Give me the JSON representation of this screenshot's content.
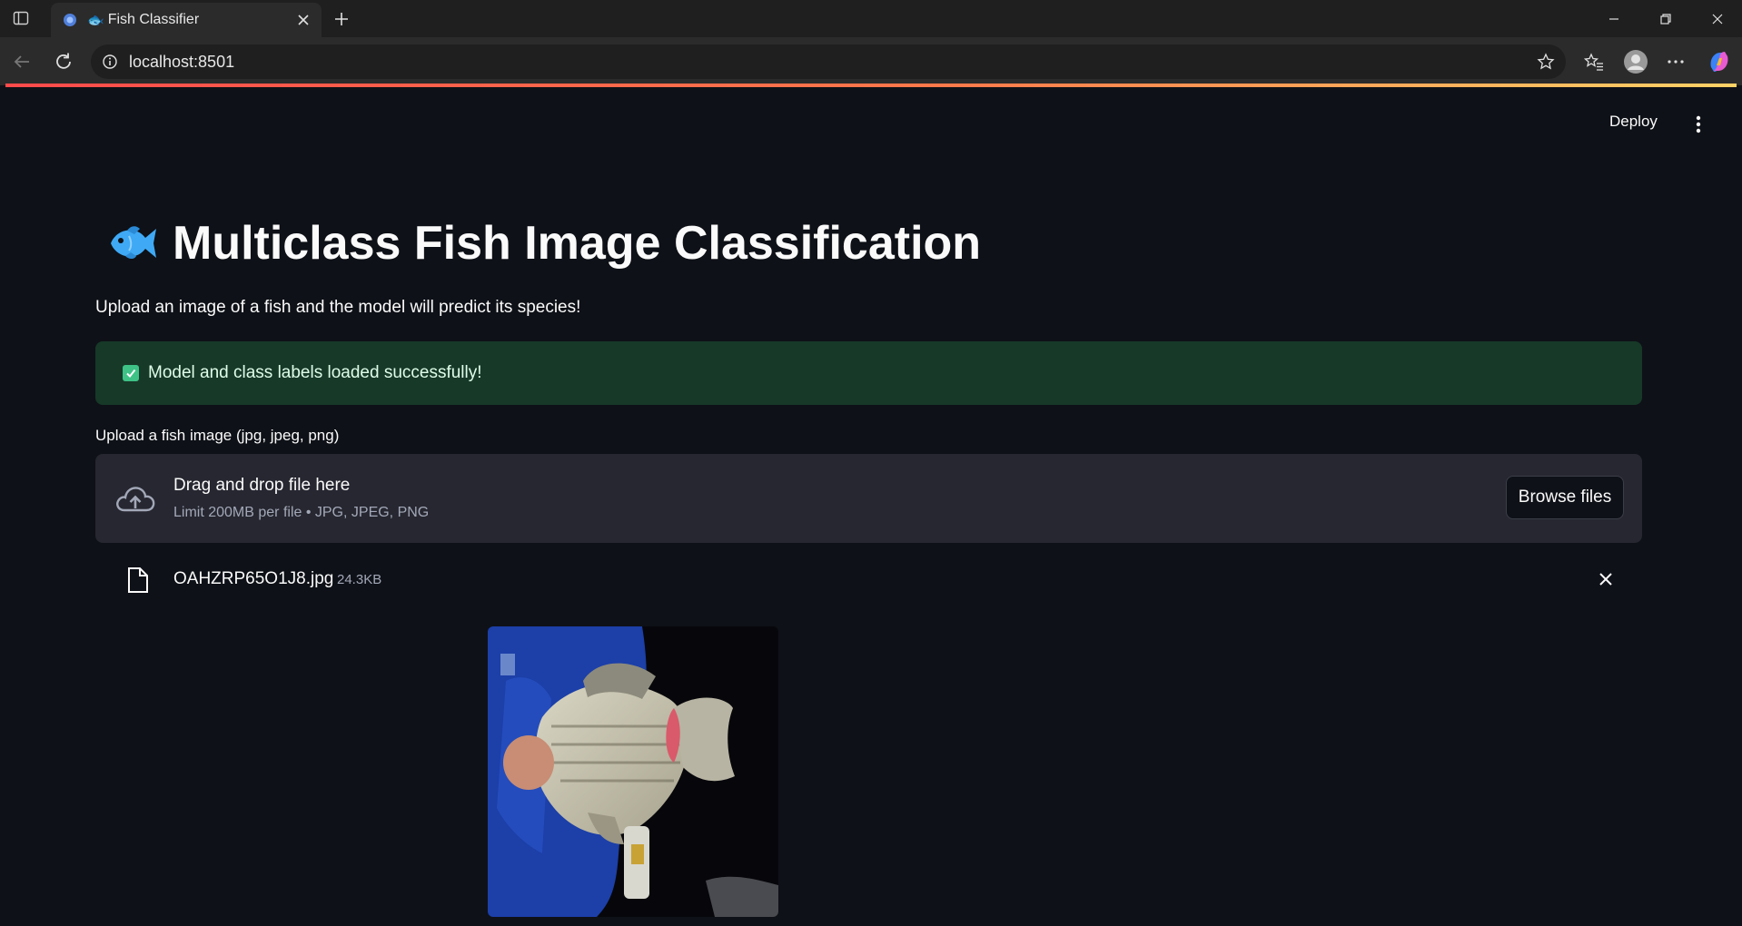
{
  "browser": {
    "tab_emoji": "🐟",
    "tab_title": "Fish Classifier",
    "url": "localhost:8501"
  },
  "app": {
    "deploy_label": "Deploy",
    "title_icon": "fish-icon",
    "title": "Multiclass Fish Image Classification",
    "subtitle": "Upload an image of a fish and the model will predict its species!",
    "success_message": "Model and class labels loaded successfully!",
    "upload": {
      "label": "Upload a fish image (jpg, jpeg, png)",
      "drop_text": "Drag and drop file here",
      "limit_text": "Limit 200MB per file • JPG, JPEG, PNG",
      "browse_label": "Browse files"
    },
    "uploaded_file": {
      "name": "OAHZRP65O1J8.jpg",
      "size": "24.3KB"
    }
  },
  "colors": {
    "background": "#0e1117",
    "success_bg": "#173928",
    "success_icon": "#3ec286",
    "dropzone_bg": "#262730",
    "accent": "#ff4b4b"
  }
}
